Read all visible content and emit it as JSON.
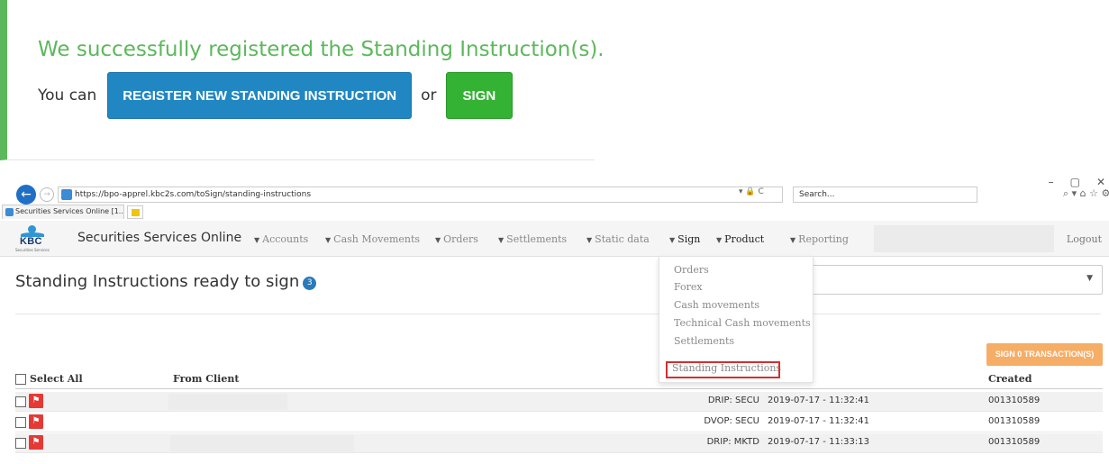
{
  "banner": {
    "title": "We successfully registered the Standing Instruction(s).",
    "you_can": "You can",
    "register_button": "REGISTER NEW STANDING INSTRUCTION",
    "or": "or",
    "sign_button": "SIGN",
    "accent_color": "#5cb85c"
  },
  "browser": {
    "window_controls": [
      "–",
      "▢",
      "✕"
    ],
    "url": "https://bpo-apprel.kbc2s.com/toSign/standing-instructions",
    "search_placeholder": "Search...",
    "tab_title": "Securities Services Online [1... ×",
    "url_tools": "▾ 🔒 C",
    "toolbar_icons": "⌕ ▾   ⌂ ☆ ⚙"
  },
  "app": {
    "logo_text": "KBC",
    "logo_subtext": "Securities Services",
    "title": "Securities Services Online",
    "nav": [
      {
        "label": "Accounts"
      },
      {
        "label": "Cash Movements"
      },
      {
        "label": "Orders"
      },
      {
        "label": "Settlements"
      },
      {
        "label": "Static data"
      },
      {
        "label": "Sign"
      },
      {
        "label": "Product"
      },
      {
        "label": "Reporting"
      }
    ],
    "logout": "Logout"
  },
  "page": {
    "title": "Standing Instructions ready to sign",
    "count": "3",
    "sign_transactions_button": "SIGN 0 TRANSACTION(S)"
  },
  "sign_menu": {
    "items": [
      "Orders",
      "Forex",
      "Cash movements",
      "Technical Cash movements",
      "Settlements",
      "Standing Instructions"
    ],
    "highlighted": "Standing Instructions"
  },
  "table": {
    "headers": {
      "select_all": "Select All",
      "from_client": "From Client",
      "created": "Created"
    },
    "rows": [
      {
        "type": "DRIP: SECU",
        "date": "2019-07-17 - 11:32:41",
        "created": "001310589"
      },
      {
        "type": "DVOP: SECU",
        "date": "2019-07-17 - 11:32:41",
        "created": "001310589"
      },
      {
        "type": "DRIP: MKTD",
        "date": "2019-07-17 - 11:33:13",
        "created": "001310589"
      }
    ]
  }
}
